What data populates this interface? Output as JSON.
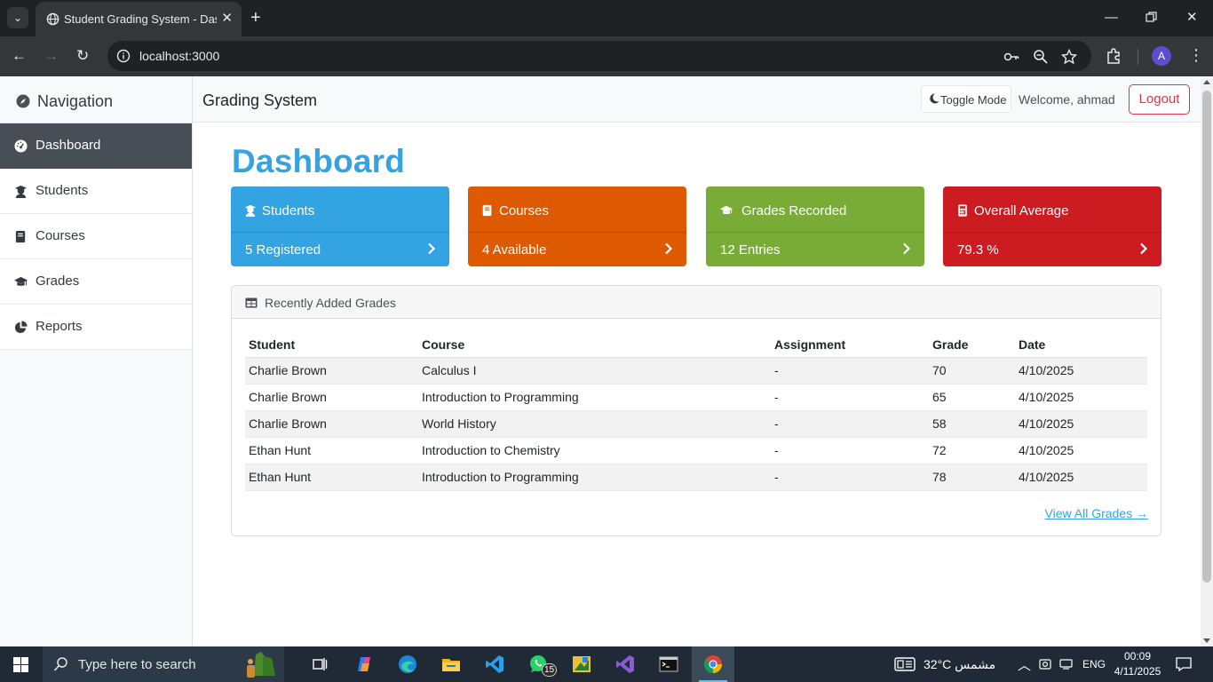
{
  "browser": {
    "tab_title": "Student Grading System - Dashboard",
    "new_tab_symbol": "+",
    "close_tab_symbol": "✕",
    "url": "localhost:3000",
    "profile_initial": "A"
  },
  "sidebar": {
    "heading": "Navigation",
    "items": [
      {
        "label": "Dashboard",
        "icon": "gauge-icon",
        "active": true
      },
      {
        "label": "Students",
        "icon": "user-graduate-icon",
        "active": false
      },
      {
        "label": "Courses",
        "icon": "book-icon",
        "active": false
      },
      {
        "label": "Grades",
        "icon": "graduation-cap-icon",
        "active": false
      },
      {
        "label": "Reports",
        "icon": "pie-chart-icon",
        "active": false
      }
    ]
  },
  "topnav": {
    "brand": "Grading System",
    "toggle_label": "Toggle Mode",
    "welcome": "Welcome, ahmad",
    "logout_label": "Logout"
  },
  "dashboard": {
    "title": "Dashboard",
    "cards": [
      {
        "title": "Students",
        "value": "5 Registered",
        "color": "#33a3e2",
        "icon": "user-graduate-icon"
      },
      {
        "title": "Courses",
        "value": "4 Available",
        "color": "#dd5902",
        "icon": "book-icon"
      },
      {
        "title": "Grades Recorded",
        "value": "12 Entries",
        "color": "#79ac37",
        "icon": "graduation-cap-icon"
      },
      {
        "title": "Overall Average",
        "value": "79.3 %",
        "color": "#cc1c22",
        "icon": "calculator-icon"
      }
    ]
  },
  "recent_grades": {
    "heading": "Recently Added Grades",
    "columns": [
      "Student",
      "Course",
      "Assignment",
      "Grade",
      "Date"
    ],
    "rows": [
      [
        "Charlie Brown",
        "Calculus I",
        "-",
        "70",
        "4/10/2025"
      ],
      [
        "Charlie Brown",
        "Introduction to Programming",
        "-",
        "65",
        "4/10/2025"
      ],
      [
        "Charlie Brown",
        "World History",
        "-",
        "58",
        "4/10/2025"
      ],
      [
        "Ethan Hunt",
        "Introduction to Chemistry",
        "-",
        "72",
        "4/10/2025"
      ],
      [
        "Ethan Hunt",
        "Introduction to Programming",
        "-",
        "78",
        "4/10/2025"
      ]
    ],
    "view_all_label": "View All Grades →"
  },
  "taskbar": {
    "search_placeholder": "Type here to search",
    "whatsapp_badge": "15",
    "weather": "32°C  مشمس",
    "language": "ENG",
    "time": "00:09",
    "date": "4/11/2025"
  },
  "colors": {
    "accent": "#36a3e0",
    "sidebar_active": "#484e55",
    "logout": "#dc3545"
  }
}
